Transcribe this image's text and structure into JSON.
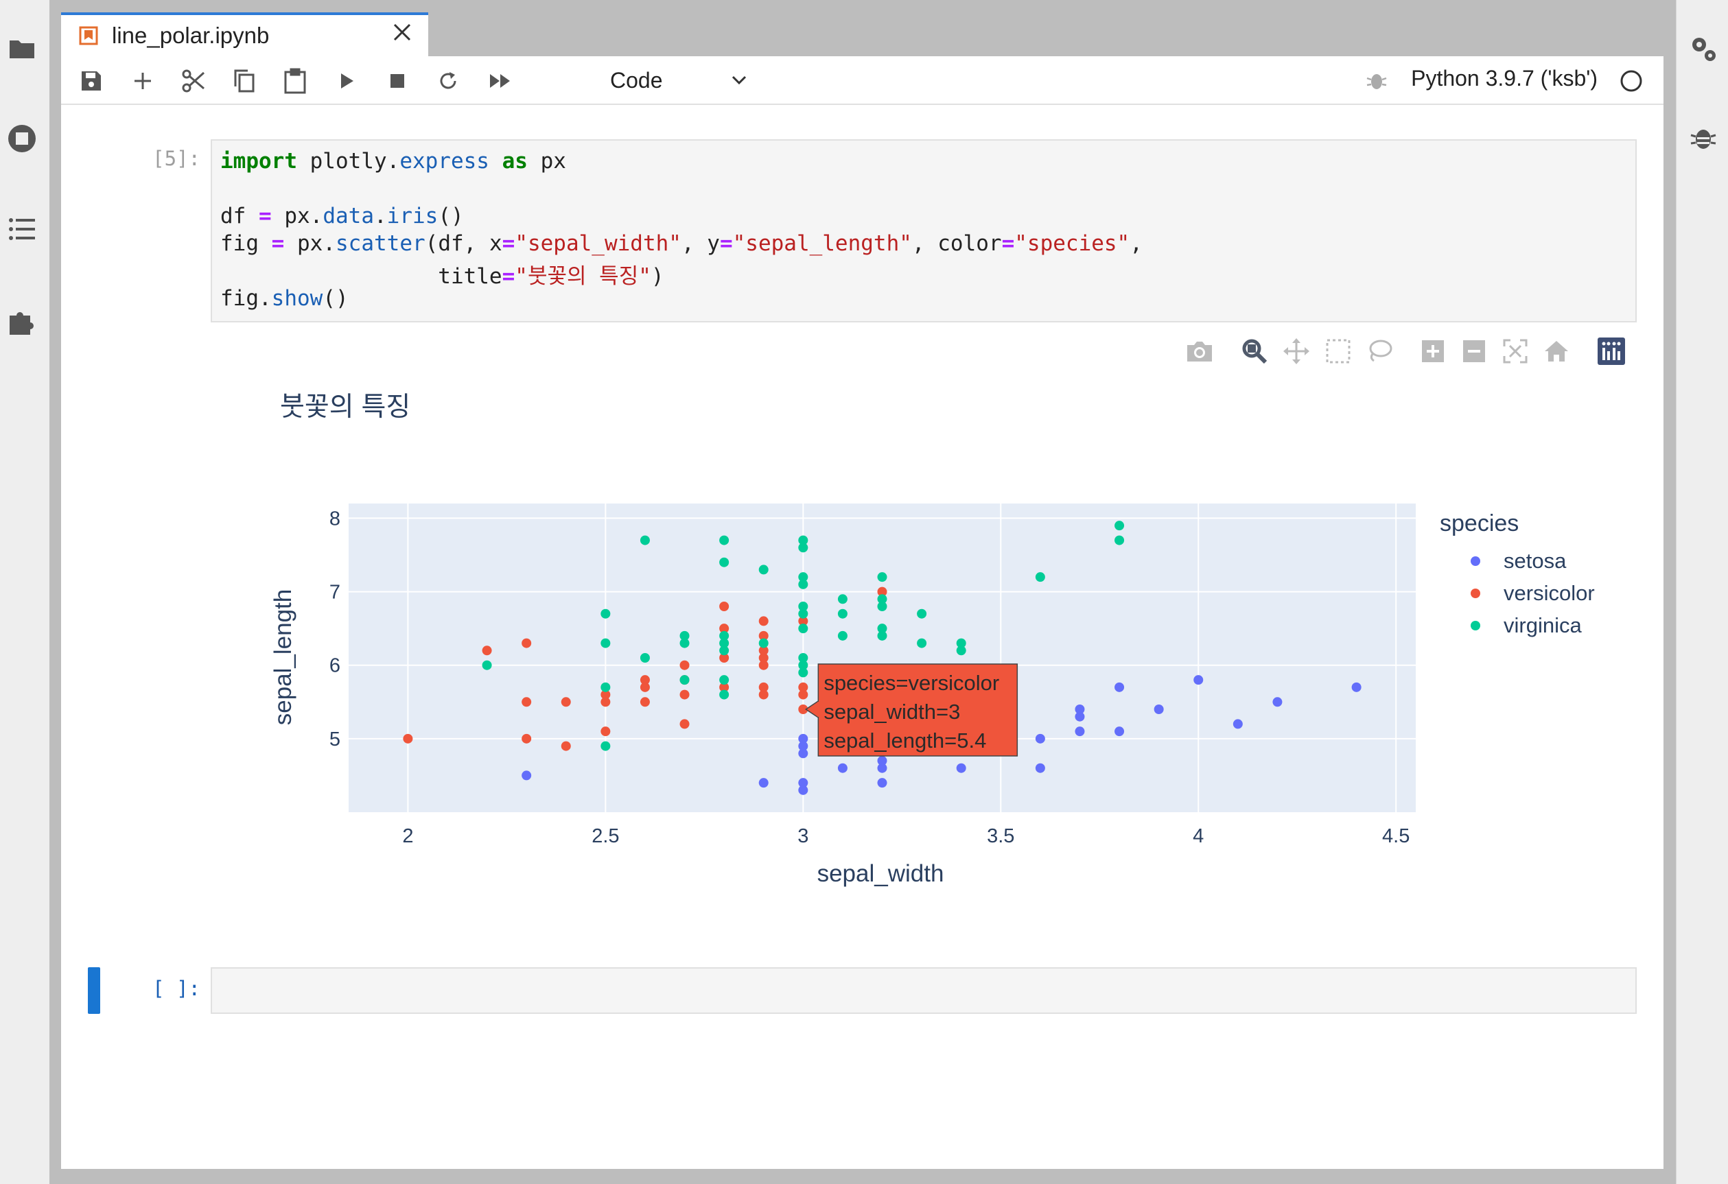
{
  "tab": {
    "title": "line_polar.ipynb"
  },
  "toolbar": {
    "cell_type": "Code",
    "kernel_name": "Python 3.9.7 ('ksb')",
    "buttons": [
      "save-icon",
      "add-cell-icon",
      "cut-icon",
      "copy-icon",
      "paste-icon",
      "run-icon",
      "stop-icon",
      "restart-icon",
      "run-all-icon"
    ]
  },
  "cells": [
    {
      "prompt": "[5]:"
    },
    {
      "prompt": "[ ]:"
    }
  ],
  "code": {
    "l1": {
      "kw1": "import",
      "mod": " plotly",
      "dot": ".",
      "sub": "express",
      "sp": " ",
      "kw2": "as",
      "alias": " px"
    },
    "l3": {
      "a": "df ",
      "eq": "=",
      "b": " px",
      "dot1": ".",
      "c": "data",
      "dot2": ".",
      "d": "iris",
      "e": "()"
    },
    "l4": {
      "a": "fig ",
      "eq": "=",
      "b": " px",
      "dot": ".",
      "c": "scatter",
      "d": "(df, x",
      "eq2": "=",
      "s1": "\"sepal_width\"",
      "e": ", y",
      "eq3": "=",
      "s2": "\"sepal_length\"",
      "f": ", color",
      "eq4": "=",
      "s3": "\"species\"",
      "g": ","
    },
    "l5": {
      "a": "                 title",
      "eq": "=",
      "s": "\"붓꽃의 특징\"",
      "b": ")"
    },
    "l6": {
      "a": "fig",
      "dot": ".",
      "b": "show",
      "c": "()"
    }
  },
  "modebar_icons": [
    "camera-icon",
    "zoom-icon",
    "pan-icon",
    "box-select-icon",
    "lasso-icon",
    "zoom-in-icon",
    "zoom-out-icon",
    "autoscale-icon",
    "reset-axes-icon",
    "plotly-logo-icon"
  ],
  "colors": {
    "setosa": "#636efa",
    "versicolor": "#ef553b",
    "virginica": "#00cc96",
    "plot_bg": "#e5ecf6",
    "axis_text": "#2a3f5f"
  },
  "chart_data": {
    "type": "scatter",
    "title": "붓꽃의 특징",
    "xlabel": "sepal_width",
    "ylabel": "sepal_length",
    "xlim": [
      1.85,
      4.55
    ],
    "ylim": [
      4.0,
      8.2
    ],
    "xticks": [
      2,
      2.5,
      3,
      3.5,
      4,
      4.5
    ],
    "xtick_labels": [
      "2",
      "2.5",
      "3",
      "3.5",
      "4",
      "4.5"
    ],
    "yticks": [
      5,
      6,
      7,
      8
    ],
    "ytick_labels": [
      "5",
      "6",
      "7",
      "8"
    ],
    "legend_title": "species",
    "legend_position": "right",
    "grid": true,
    "series": [
      {
        "name": "setosa",
        "color": "#636efa",
        "points": [
          [
            2.3,
            4.5
          ],
          [
            2.9,
            4.4
          ],
          [
            3.0,
            4.3
          ],
          [
            3.0,
            4.4
          ],
          [
            3.0,
            4.8
          ],
          [
            3.0,
            4.9
          ],
          [
            3.0,
            5.0
          ],
          [
            3.1,
            4.6
          ],
          [
            3.1,
            4.9
          ],
          [
            3.2,
            4.4
          ],
          [
            3.2,
            4.6
          ],
          [
            3.2,
            4.7
          ],
          [
            3.4,
            4.6
          ],
          [
            3.6,
            4.6
          ],
          [
            3.6,
            5.0
          ],
          [
            3.7,
            5.1
          ],
          [
            3.7,
            5.3
          ],
          [
            3.7,
            5.4
          ],
          [
            3.8,
            5.1
          ],
          [
            3.8,
            5.7
          ],
          [
            3.9,
            5.4
          ],
          [
            4.0,
            5.8
          ],
          [
            4.1,
            5.2
          ],
          [
            4.2,
            5.5
          ],
          [
            4.4,
            5.7
          ]
        ]
      },
      {
        "name": "versicolor",
        "color": "#ef553b",
        "points": [
          [
            2.0,
            5.0
          ],
          [
            2.2,
            6.2
          ],
          [
            2.3,
            5.0
          ],
          [
            2.3,
            5.5
          ],
          [
            2.3,
            6.3
          ],
          [
            2.4,
            4.9
          ],
          [
            2.4,
            5.5
          ],
          [
            2.5,
            5.1
          ],
          [
            2.5,
            5.5
          ],
          [
            2.5,
            5.6
          ],
          [
            2.6,
            5.5
          ],
          [
            2.6,
            5.7
          ],
          [
            2.6,
            5.8
          ],
          [
            2.7,
            5.2
          ],
          [
            2.7,
            5.6
          ],
          [
            2.7,
            5.8
          ],
          [
            2.7,
            6.0
          ],
          [
            2.8,
            5.7
          ],
          [
            2.8,
            6.1
          ],
          [
            2.8,
            6.5
          ],
          [
            2.8,
            6.8
          ],
          [
            2.9,
            5.6
          ],
          [
            2.9,
            5.7
          ],
          [
            2.9,
            6.0
          ],
          [
            2.9,
            6.1
          ],
          [
            2.9,
            6.2
          ],
          [
            2.9,
            6.4
          ],
          [
            2.9,
            6.6
          ],
          [
            3.0,
            5.4
          ],
          [
            3.0,
            5.6
          ],
          [
            3.0,
            5.7
          ],
          [
            3.0,
            6.6
          ],
          [
            3.2,
            7.0
          ]
        ]
      },
      {
        "name": "virginica",
        "color": "#00cc96",
        "points": [
          [
            2.2,
            6.0
          ],
          [
            2.5,
            4.9
          ],
          [
            2.5,
            5.7
          ],
          [
            2.5,
            6.3
          ],
          [
            2.5,
            6.7
          ],
          [
            2.6,
            6.1
          ],
          [
            2.6,
            7.7
          ],
          [
            2.7,
            5.8
          ],
          [
            2.7,
            6.3
          ],
          [
            2.7,
            6.4
          ],
          [
            2.8,
            5.6
          ],
          [
            2.8,
            5.8
          ],
          [
            2.8,
            6.2
          ],
          [
            2.8,
            6.3
          ],
          [
            2.8,
            6.4
          ],
          [
            2.8,
            7.4
          ],
          [
            2.8,
            7.7
          ],
          [
            2.9,
            6.3
          ],
          [
            2.9,
            7.3
          ],
          [
            3.0,
            5.9
          ],
          [
            3.0,
            6.0
          ],
          [
            3.0,
            6.1
          ],
          [
            3.0,
            6.5
          ],
          [
            3.0,
            6.7
          ],
          [
            3.0,
            6.8
          ],
          [
            3.0,
            7.1
          ],
          [
            3.0,
            7.2
          ],
          [
            3.0,
            7.6
          ],
          [
            3.0,
            7.7
          ],
          [
            3.1,
            6.4
          ],
          [
            3.1,
            6.7
          ],
          [
            3.1,
            6.9
          ],
          [
            3.2,
            6.4
          ],
          [
            3.2,
            6.5
          ],
          [
            3.2,
            6.8
          ],
          [
            3.2,
            6.9
          ],
          [
            3.2,
            7.2
          ],
          [
            3.3,
            6.3
          ],
          [
            3.3,
            6.7
          ],
          [
            3.4,
            6.2
          ],
          [
            3.4,
            6.3
          ],
          [
            3.6,
            7.2
          ],
          [
            3.8,
            7.7
          ],
          [
            3.8,
            7.9
          ]
        ]
      }
    ],
    "hover": {
      "x": 3.0,
      "y": 5.4,
      "color": "#ef553b",
      "lines": [
        "species=versicolor",
        "sepal_width=3",
        "sepal_length=5.4"
      ]
    }
  }
}
